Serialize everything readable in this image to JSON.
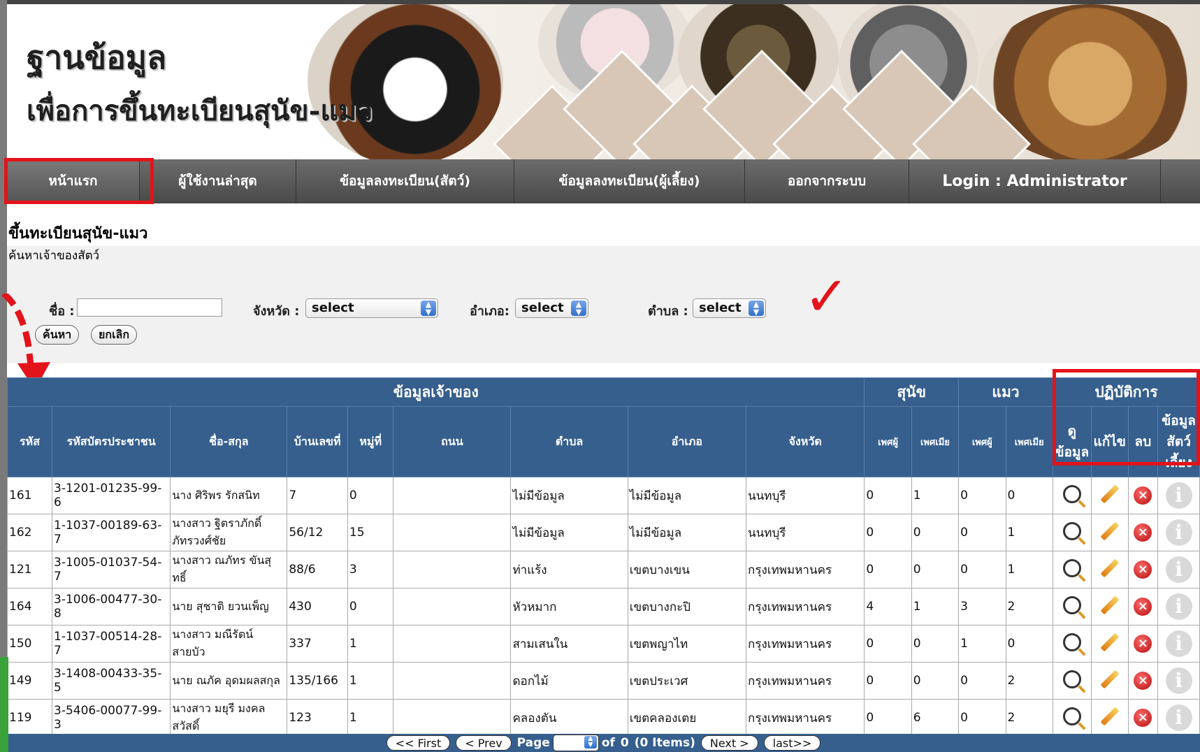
{
  "header": {
    "title_line1": "ฐานข้อมูล",
    "title_line2": "เพื่อการขึ้นทะเบียนสุนัข-แมว"
  },
  "nav": {
    "home": "หน้าแรก",
    "latest_users": "ผู้ใช้งานล่าสุด",
    "animal_registration": "ข้อมูลลงทะเบียน(สัตว์)",
    "owner_registration": "ข้อมูลลงทะเบียน(ผู้เลี้ยง)",
    "logout": "ออกจากระบบ",
    "login_status": "Login : Administrator"
  },
  "page": {
    "title": "ขึ้นทะเบียนสุนัข-แมว",
    "subtitle": "ค้นหาเจ้าของสัตว์"
  },
  "search": {
    "name_label": "ชื่อ :",
    "name_value": "",
    "province_label": "จังหวัด :",
    "province_value": "select",
    "district_label": "อำเภอ:",
    "district_value": "select",
    "subdistrict_label": "ตำบล :",
    "subdistrict_value": "select",
    "search_button": "ค้นหา",
    "cancel_button": "ยกเลิก"
  },
  "table": {
    "group_headers": {
      "owner_info": "ข้อมูลเจ้าของ",
      "dog": "สุนัข",
      "cat": "แมว",
      "actions": "ปฏิบัติการ"
    },
    "columns": {
      "id": "รหัส",
      "citizen_id": "รหัสบัตรประชาชน",
      "name": "ชื่อ-สกุล",
      "house_no": "บ้านเลขที่",
      "moo": "หมู่ที่",
      "road": "ถนน",
      "subdistrict": "ตำบล",
      "district": "อำเภอ",
      "province": "จังหวัด",
      "dog_male": "เพศผู้",
      "dog_female": "เพศเมีย",
      "cat_male": "เพศผู้",
      "cat_female": "เพศเมีย",
      "view": "ดู ข้อมูล",
      "edit": "แก้ไข",
      "delete": "ลบ",
      "pet_info": "ข้อมูล สัตว์ เลี้ยง"
    },
    "rows": [
      {
        "id": "161",
        "citizen_id": "3-1201-01235-99-6",
        "name": "นาง ศิริพร รักสนิท",
        "house_no": "7",
        "moo": "0",
        "road": "",
        "subdistrict": "ไม่มีข้อมูล",
        "district": "ไม่มีข้อมูล",
        "province": "นนทบุรี",
        "dog_male": "0",
        "dog_female": "1",
        "cat_male": "0",
        "cat_female": "0"
      },
      {
        "id": "162",
        "citizen_id": "1-1037-00189-63-7",
        "name": "นางสาว ฐิตราภักดิ์ ภัทรวงศ์ชัย",
        "house_no": "56/12",
        "moo": "15",
        "road": "",
        "subdistrict": "ไม่มีข้อมูล",
        "district": "ไม่มีข้อมูล",
        "province": "นนทบุรี",
        "dog_male": "0",
        "dog_female": "0",
        "cat_male": "0",
        "cat_female": "1"
      },
      {
        "id": "121",
        "citizen_id": "3-1005-01037-54-7",
        "name": "นางสาว ณภัทร ขันสุทธิ์",
        "house_no": "88/6",
        "moo": "3",
        "road": "",
        "subdistrict": "ท่าแร้ง",
        "district": "เขตบางเขน",
        "province": "กรุงเทพมหานคร",
        "dog_male": "0",
        "dog_female": "0",
        "cat_male": "0",
        "cat_female": "1"
      },
      {
        "id": "164",
        "citizen_id": "3-1006-00477-30-8",
        "name": "นาย สุชาติ ยวนเพ็ญ",
        "house_no": "430",
        "moo": "0",
        "road": "",
        "subdistrict": "หัวหมาก",
        "district": "เขตบางกะปิ",
        "province": "กรุงเทพมหานคร",
        "dog_male": "4",
        "dog_female": "1",
        "cat_male": "3",
        "cat_female": "2"
      },
      {
        "id": "150",
        "citizen_id": "1-1037-00514-28-7",
        "name": "นางสาว มณีรัตน์ สายบัว",
        "house_no": "337",
        "moo": "1",
        "road": "",
        "subdistrict": "สามเสนใน",
        "district": "เขตพญาไท",
        "province": "กรุงเทพมหานคร",
        "dog_male": "0",
        "dog_female": "0",
        "cat_male": "1",
        "cat_female": "0"
      },
      {
        "id": "149",
        "citizen_id": "3-1408-00433-35-5",
        "name": "นาย ณภัค อุดมผลสกุล",
        "house_no": "135/166",
        "moo": "1",
        "road": "",
        "subdistrict": "ดอกไม้",
        "district": "เขตประเวศ",
        "province": "กรุงเทพมหานคร",
        "dog_male": "0",
        "dog_female": "0",
        "cat_male": "0",
        "cat_female": "2"
      },
      {
        "id": "119",
        "citizen_id": "3-5406-00077-99-3",
        "name": "นางสาว มยุรี มงคลสวัสดิ์",
        "house_no": "123",
        "moo": "1",
        "road": "",
        "subdistrict": "คลองตัน",
        "district": "เขตคลองเตย",
        "province": "กรุงเทพมหานคร",
        "dog_male": "0",
        "dog_female": "6",
        "cat_male": "0",
        "cat_female": "2"
      }
    ]
  },
  "pager": {
    "first": "<< First",
    "prev": "< Prev",
    "page_label": "Page",
    "of_label": "of",
    "total_pages": "0",
    "items_label": "(0 Items)",
    "next": "Next >",
    "last": "last>>"
  },
  "colors": {
    "accent_red": "#e3131b",
    "table_header": "#365f8e",
    "nav_bg": "#5a5a5a"
  },
  "icons": [
    "magnifier-icon",
    "pencil-icon",
    "delete-icon",
    "info-icon",
    "check-mark-icon",
    "arrow-annotation-icon"
  ]
}
